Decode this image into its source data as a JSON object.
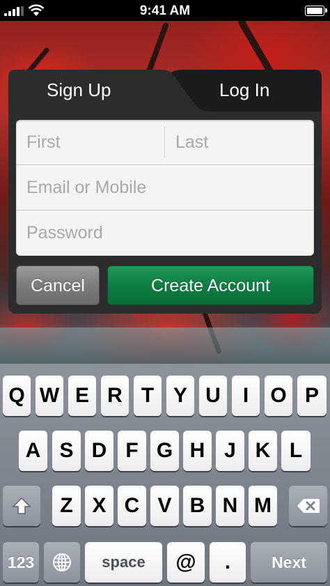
{
  "status_bar": {
    "time": "9:41 AM"
  },
  "tabs": {
    "signup": "Sign Up",
    "login": "Log In",
    "active": "signup"
  },
  "form": {
    "first_placeholder": "First",
    "last_placeholder": "Last",
    "email_placeholder": "Email or Mobile",
    "password_placeholder": "Password"
  },
  "buttons": {
    "cancel": "Cancel",
    "create": "Create Account"
  },
  "keyboard": {
    "row1": [
      "Q",
      "W",
      "E",
      "R",
      "T",
      "Y",
      "U",
      "I",
      "O",
      "P"
    ],
    "row2": [
      "A",
      "S",
      "D",
      "F",
      "G",
      "H",
      "J",
      "K",
      "L"
    ],
    "row3": [
      "Z",
      "X",
      "C",
      "V",
      "B",
      "N",
      "M"
    ],
    "numbers_key": "123",
    "space_key": "space",
    "at_key": "@",
    "period_key": ".",
    "next_key": "Next",
    "icons": {
      "shift": "shift-icon",
      "delete": "backspace-icon",
      "globe": "globe-icon"
    }
  },
  "colors": {
    "create_button": "#0d7d43",
    "panel": "#2c2c2c"
  }
}
